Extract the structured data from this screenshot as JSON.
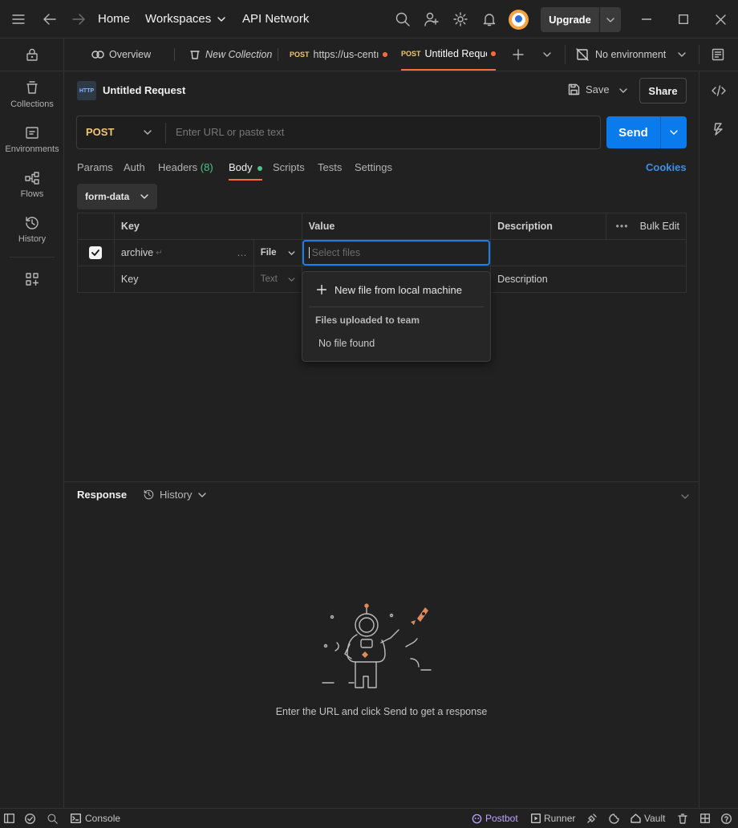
{
  "topbar": {
    "home": "Home",
    "workspaces": "Workspaces",
    "api_network": "API Network",
    "upgrade": "Upgrade"
  },
  "sidebar": {
    "items": [
      {
        "label": "Collections",
        "icon": "collections-icon"
      },
      {
        "label": "Environments",
        "icon": "environments-icon"
      },
      {
        "label": "Flows",
        "icon": "flows-icon"
      },
      {
        "label": "History",
        "icon": "history-icon"
      }
    ]
  },
  "tabs": {
    "overview": "Overview",
    "new_collection": "New Collection",
    "tab1_method": "POST",
    "tab1_label": "https://us-centı",
    "tab2_method": "POST",
    "tab2_label": "Untitled Reque",
    "environment": "No environment"
  },
  "request": {
    "title": "Untitled Request",
    "save": "Save",
    "share": "Share",
    "method": "POST",
    "url_placeholder": "Enter URL or paste text",
    "send": "Send"
  },
  "subtabs": {
    "params": "Params",
    "auth": "Auth",
    "headers": "Headers",
    "headers_count": "(8)",
    "body": "Body",
    "scripts": "Scripts",
    "tests": "Tests",
    "settings": "Settings",
    "cookies": "Cookies"
  },
  "body_type": "form-data",
  "table": {
    "headers": {
      "key": "Key",
      "value": "Value",
      "description": "Description",
      "bulk_edit": "Bulk Edit"
    },
    "row1": {
      "key": "archive",
      "type": "File",
      "value_placeholder": "Select files"
    },
    "row2": {
      "key_placeholder": "Key",
      "type": "Text",
      "description_placeholder": "Description"
    }
  },
  "dropdown": {
    "new_file": "New file from local machine",
    "section": "Files uploaded to team",
    "empty": "No file found"
  },
  "response": {
    "title": "Response",
    "history": "History",
    "empty_message": "Enter the URL and click Send to get a response"
  },
  "statusbar": {
    "console": "Console",
    "postbot": "Postbot",
    "runner": "Runner",
    "vault": "Vault"
  },
  "colors": {
    "accent": "#ff6c37",
    "send": "#097bed",
    "post_method": "#f0c674",
    "cookies_link": "#3d8fe8",
    "headers_count": "#4cc38a",
    "focus_border": "#1a7fe6"
  }
}
